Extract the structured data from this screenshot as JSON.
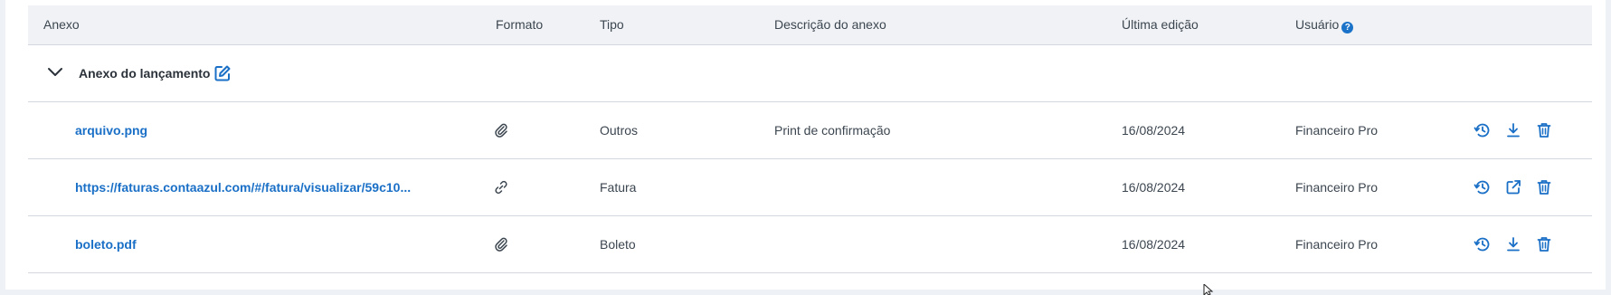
{
  "table": {
    "headers": {
      "anexo": "Anexo",
      "formato": "Formato",
      "tipo": "Tipo",
      "descricao": "Descrição do anexo",
      "ultima_edicao": "Última edição",
      "usuario": "Usuário"
    },
    "usuario_help_glyph": "?",
    "group": {
      "title": "Anexo do lançamento"
    },
    "rows": [
      {
        "anexo": "arquivo.png",
        "formato_icon": "paperclip-icon",
        "tipo": "Outros",
        "descricao": "Print de confirmação",
        "ultima_edicao": "16/08/2024",
        "usuario": "Financeiro Pro",
        "actions": [
          "history-icon",
          "download-icon",
          "trash-icon"
        ]
      },
      {
        "anexo": "https://faturas.contaazul.com/#/fatura/visualizar/59c10...",
        "formato_icon": "link-icon",
        "tipo": "Fatura",
        "descricao": "",
        "ultima_edicao": "16/08/2024",
        "usuario": "Financeiro Pro",
        "actions": [
          "history-icon",
          "external-link-icon",
          "trash-icon"
        ]
      },
      {
        "anexo": "boleto.pdf",
        "formato_icon": "paperclip-icon",
        "tipo": "Boleto",
        "descricao": "",
        "ultima_edicao": "16/08/2024",
        "usuario": "Financeiro Pro",
        "actions": [
          "history-icon",
          "download-icon",
          "trash-icon"
        ]
      }
    ]
  },
  "colors": {
    "accent": "#1a6fc6",
    "header_bg": "#f0f2f5",
    "page_bg": "#eef1f5",
    "divider": "#d3d8de"
  }
}
